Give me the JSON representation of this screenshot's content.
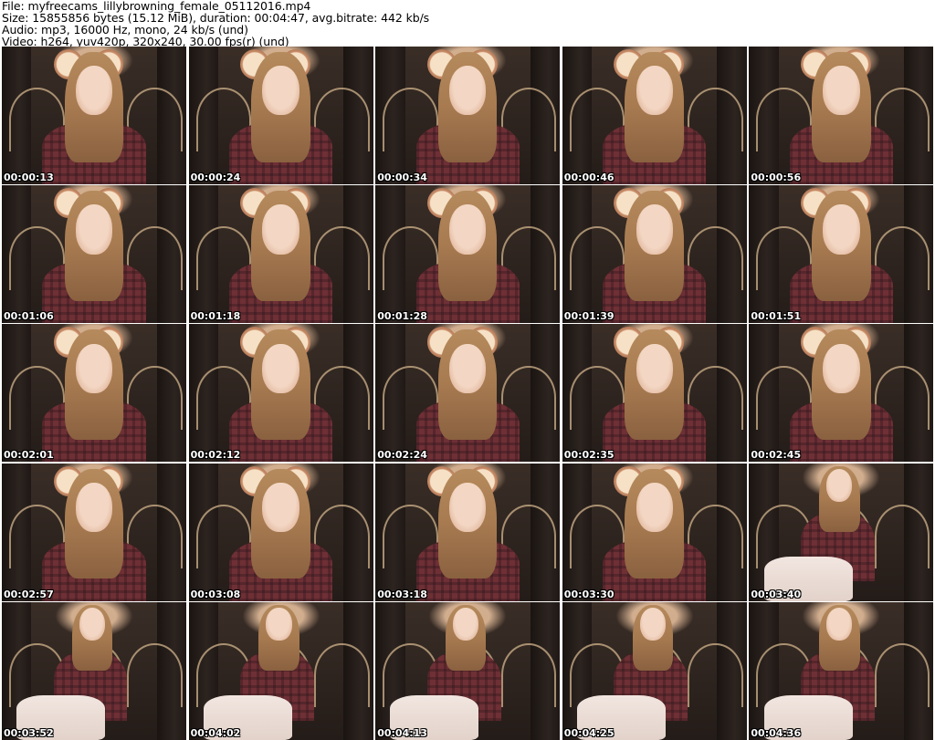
{
  "header": {
    "file_line": "File: myfreecams_lillybrowning_female_05112016.mp4",
    "size_line": "Size: 15855856 bytes (15.12 MiB), duration: 00:04:47, avg.bitrate: 442 kb/s",
    "audio_line": "Audio: mp3, 16000 Hz, mono, 24 kb/s (und)",
    "video_line": "Video: h264, yuv420p, 320x240, 30.00 fps(r) (und)"
  },
  "thumbnails": [
    {
      "timestamp": "00:00:13",
      "scene": "portrait"
    },
    {
      "timestamp": "00:00:24",
      "scene": "portrait"
    },
    {
      "timestamp": "00:00:34",
      "scene": "portrait"
    },
    {
      "timestamp": "00:00:46",
      "scene": "portrait"
    },
    {
      "timestamp": "00:00:56",
      "scene": "portrait"
    },
    {
      "timestamp": "00:01:06",
      "scene": "portrait"
    },
    {
      "timestamp": "00:01:18",
      "scene": "portrait"
    },
    {
      "timestamp": "00:01:28",
      "scene": "portrait"
    },
    {
      "timestamp": "00:01:39",
      "scene": "portrait"
    },
    {
      "timestamp": "00:01:51",
      "scene": "portrait"
    },
    {
      "timestamp": "00:02:01",
      "scene": "portrait"
    },
    {
      "timestamp": "00:02:12",
      "scene": "portrait"
    },
    {
      "timestamp": "00:02:24",
      "scene": "portrait"
    },
    {
      "timestamp": "00:02:35",
      "scene": "portrait"
    },
    {
      "timestamp": "00:02:45",
      "scene": "portrait"
    },
    {
      "timestamp": "00:02:57",
      "scene": "portrait"
    },
    {
      "timestamp": "00:03:08",
      "scene": "portrait"
    },
    {
      "timestamp": "00:03:18",
      "scene": "portrait"
    },
    {
      "timestamp": "00:03:30",
      "scene": "portrait"
    },
    {
      "timestamp": "00:03:40",
      "scene": "seated"
    },
    {
      "timestamp": "00:03:52",
      "scene": "seated"
    },
    {
      "timestamp": "00:04:02",
      "scene": "seated"
    },
    {
      "timestamp": "00:04:13",
      "scene": "seated"
    },
    {
      "timestamp": "00:04:25",
      "scene": "seated"
    },
    {
      "timestamp": "00:04:36",
      "scene": "seated"
    }
  ],
  "colors": {
    "background": "#ffffff",
    "timestamp_text": "#ffffff",
    "timestamp_outline": "#000000",
    "shirt": "#6e2f35",
    "hair": "#a77a50"
  }
}
